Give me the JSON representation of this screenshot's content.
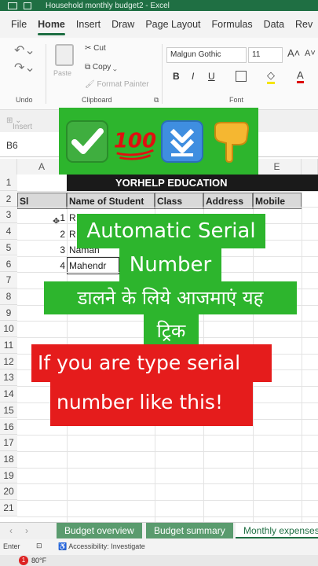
{
  "window": {
    "title": "Household monthly budget2  -  Excel"
  },
  "menu": [
    "File",
    "Home",
    "Insert",
    "Draw",
    "Page Layout",
    "Formulas",
    "Data",
    "Rev"
  ],
  "ribbon": {
    "undo_label": "Undo",
    "clipboard_label": "Clipboard",
    "paste_label": "Paste",
    "cut_label": "Cut",
    "copy_label": "Copy",
    "format_painter_label": "Format Painter",
    "font_label": "Font",
    "font_name": "Malgun Gothic",
    "font_size": "11",
    "bold": "B",
    "italic": "I",
    "underline": "U",
    "insert_label": "Insert"
  },
  "name_box": "B6",
  "columns": [
    "A",
    "E"
  ],
  "rows": [
    "1",
    "2",
    "3",
    "4",
    "5",
    "6",
    "7",
    "8",
    "9",
    "10",
    "11",
    "12",
    "13",
    "14",
    "15",
    "16",
    "17",
    "18",
    "19",
    "20",
    "21"
  ],
  "sheet": {
    "banner": "YORHELP EDUCATION",
    "headers": [
      "Sl",
      "Name of Student",
      "Class",
      "Address",
      "Mobile"
    ],
    "data": [
      {
        "sl": "1",
        "name": "R"
      },
      {
        "sl": "2",
        "name": "R"
      },
      {
        "sl": "3",
        "name": "Naman"
      },
      {
        "sl": "4",
        "name": "Mahendr"
      }
    ]
  },
  "overlays": {
    "line1": "Automatic Serial",
    "line2": "Number",
    "line3": "डालने के लिये आजमाएं यह",
    "line4": "ट्रिक",
    "red1": "If you are type serial",
    "red2": "number like this!",
    "emoji": [
      "check-mark",
      "hundred-points",
      "down-arrows",
      "pointing-down"
    ],
    "emoji_text": "100"
  },
  "sheet_tabs": [
    "Budget overview",
    "Budget summary",
    "Monthly expenses"
  ],
  "status": {
    "mode": "Enter",
    "accessibility": "Accessibility: Investigate"
  },
  "taskbar": {
    "badge": "1",
    "weather": "80°F"
  },
  "colors": {
    "excel_green": "#1f6f43",
    "overlay_green": "#2db52d",
    "overlay_red": "#e51c1c",
    "banner_bg": "#1a1a1a"
  }
}
